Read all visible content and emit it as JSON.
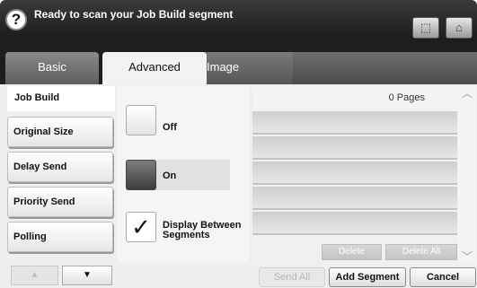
{
  "header": {
    "title": "Ready to scan your Job Build segment",
    "help_icon": "?"
  },
  "tabs": [
    {
      "label": "Basic"
    },
    {
      "label": "Advanced",
      "selected": true
    },
    {
      "label": "Image"
    }
  ],
  "toolbar": {
    "load_icon": "⬚",
    "home_icon": "⌂"
  },
  "sidebar": {
    "heading": "Job Build",
    "items": [
      "Original Size",
      "Delay Send",
      "Priority Send",
      "Polling"
    ],
    "nav_up": "▲",
    "nav_down": "▼"
  },
  "options": {
    "off_label": "Off",
    "on_label": "On",
    "selected": "On",
    "display_label_line1": "Display Between",
    "display_label_line2": "Segments",
    "display_checked": true,
    "check_glyph": "✓"
  },
  "list": {
    "pages_count": "0 Pages",
    "delete_label": "Delete",
    "delete_all_label": "Delete All",
    "scroll_up": "︿",
    "scroll_down": "﹀"
  },
  "footer": {
    "send_all_label": "Send All",
    "add_segment_label": "Add Segment",
    "cancel_label": "Cancel"
  }
}
